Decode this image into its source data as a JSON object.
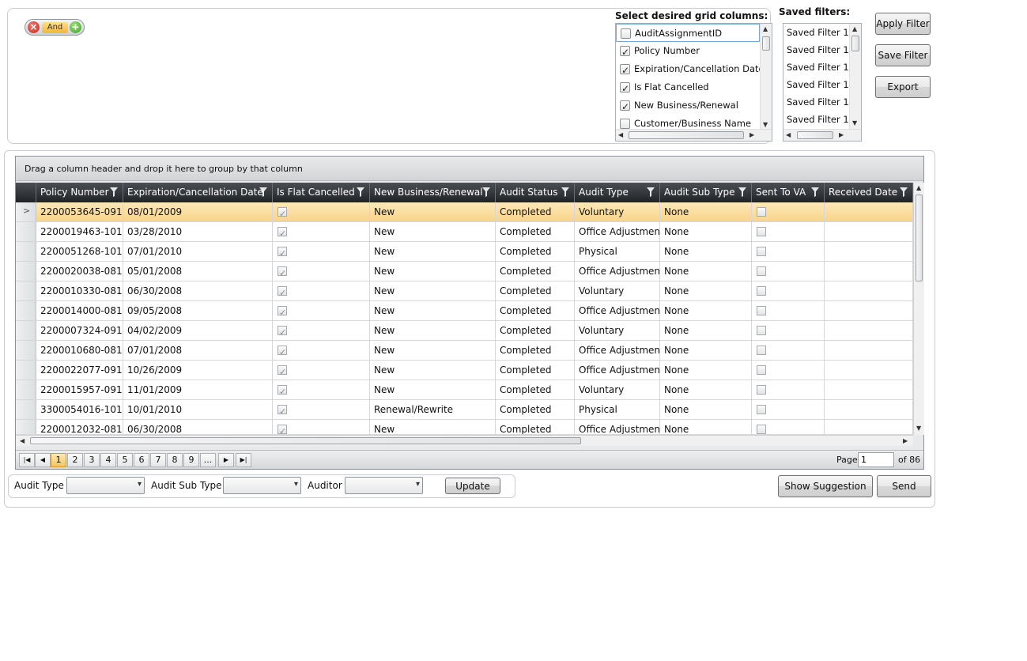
{
  "filter": {
    "operator_label": "And",
    "columns_title": "Select desired grid columns:",
    "columns": [
      {
        "label": "AuditAssignmentID",
        "checked": false
      },
      {
        "label": "Policy Number",
        "checked": true
      },
      {
        "label": "Expiration/Cancellation Date",
        "checked": true
      },
      {
        "label": "Is Flat Cancelled",
        "checked": true
      },
      {
        "label": "New Business/Renewal",
        "checked": true
      },
      {
        "label": "Customer/Business Name",
        "checked": false
      }
    ],
    "saved_title": "Saved filters:",
    "saved": [
      "Saved Filter 1",
      "Saved Filter 1",
      "Saved Filter 1",
      "Saved Filter 1",
      "Saved Filter 1",
      "Saved Filter 1"
    ],
    "apply_label": "Apply Filter",
    "save_label": "Save Filter",
    "export_label": "Export"
  },
  "grid": {
    "group_hint": "Drag a column header and drop it here to group by that column",
    "columns": [
      "Policy Number",
      "Expiration/Cancellation Date",
      "Is Flat Cancelled",
      "New Business/Renewal",
      "Audit Status",
      "Audit Type",
      "Audit Sub Type",
      "Sent To VA",
      "Received Date"
    ],
    "rows": [
      {
        "policy": "2200053645-091",
        "date": "08/01/2009",
        "flat": true,
        "nbr": "New",
        "status": "Completed",
        "type": "Voluntary",
        "sub": "None",
        "va": false,
        "received": ""
      },
      {
        "policy": "2200019463-101",
        "date": "03/28/2010",
        "flat": true,
        "nbr": "New",
        "status": "Completed",
        "type": "Office Adjustment",
        "sub": "None",
        "va": false,
        "received": ""
      },
      {
        "policy": "2200051268-101",
        "date": "07/01/2010",
        "flat": true,
        "nbr": "New",
        "status": "Completed",
        "type": "Physical",
        "sub": "None",
        "va": false,
        "received": ""
      },
      {
        "policy": "2200020038-081",
        "date": "05/01/2008",
        "flat": true,
        "nbr": "New",
        "status": "Completed",
        "type": "Office Adjustment",
        "sub": "None",
        "va": false,
        "received": ""
      },
      {
        "policy": "2200010330-081",
        "date": "06/30/2008",
        "flat": true,
        "nbr": "New",
        "status": "Completed",
        "type": "Voluntary",
        "sub": "None",
        "va": false,
        "received": ""
      },
      {
        "policy": "2200014000-081",
        "date": "09/05/2008",
        "flat": true,
        "nbr": "New",
        "status": "Completed",
        "type": "Office Adjustment",
        "sub": "None",
        "va": false,
        "received": ""
      },
      {
        "policy": "2200007324-091",
        "date": "04/02/2009",
        "flat": true,
        "nbr": "New",
        "status": "Completed",
        "type": "Voluntary",
        "sub": "None",
        "va": false,
        "received": ""
      },
      {
        "policy": "2200010680-081",
        "date": "07/01/2008",
        "flat": true,
        "nbr": "New",
        "status": "Completed",
        "type": "Office Adjustment",
        "sub": "None",
        "va": false,
        "received": ""
      },
      {
        "policy": "2200022077-091",
        "date": "10/26/2009",
        "flat": true,
        "nbr": "New",
        "status": "Completed",
        "type": "Office Adjustment",
        "sub": "None",
        "va": false,
        "received": ""
      },
      {
        "policy": "2200015957-091",
        "date": "11/01/2009",
        "flat": true,
        "nbr": "New",
        "status": "Completed",
        "type": "Voluntary",
        "sub": "None",
        "va": false,
        "received": ""
      },
      {
        "policy": "3300054016-101",
        "date": "10/01/2010",
        "flat": true,
        "nbr": "Renewal/Rewrite",
        "status": "Completed",
        "type": "Physical",
        "sub": "None",
        "va": false,
        "received": ""
      },
      {
        "policy": "2200012032-081",
        "date": "06/30/2008",
        "flat": true,
        "nbr": "New",
        "status": "Completed",
        "type": "Office Adjustment",
        "sub": "None",
        "va": false,
        "received": ""
      }
    ],
    "selected_row": 0,
    "pager": {
      "pages": [
        "1",
        "2",
        "3",
        "4",
        "5",
        "6",
        "7",
        "8",
        "9",
        "..."
      ],
      "current": "1",
      "page_label": "Page",
      "page_value": "1",
      "of_label": "of 86"
    }
  },
  "bottom": {
    "audit_type_label": "Audit Type",
    "audit_sub_type_label": "Audit Sub Type",
    "auditor_label": "Auditor",
    "update_label": "Update",
    "show_suggestion_label": "Show Suggestion",
    "send_label": "Send"
  }
}
